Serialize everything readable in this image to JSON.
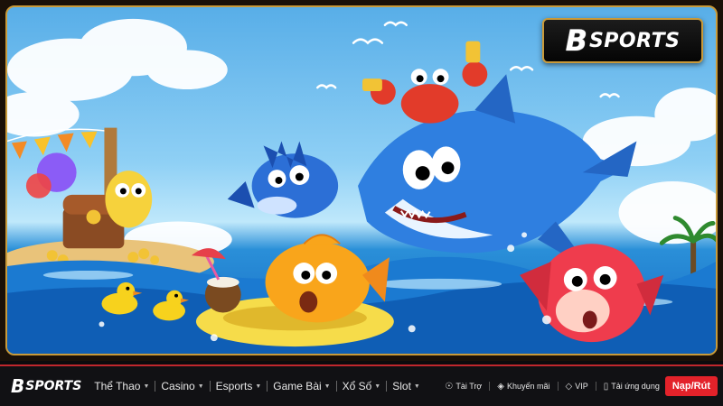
{
  "hero": {
    "badge_b": "B",
    "badge_word": "SPORTS"
  },
  "nav": {
    "logo_b": "B",
    "logo_word": "SPORTS",
    "menu": [
      {
        "label": "Thể Thao"
      },
      {
        "label": "Casino"
      },
      {
        "label": "Esports"
      },
      {
        "label": "Game Bài"
      },
      {
        "label": "Xổ Số"
      },
      {
        "label": "Slot"
      }
    ],
    "quick": [
      {
        "label": "Tài Trợ",
        "icon": "sponsor-icon"
      },
      {
        "label": "Khuyến mãi",
        "icon": "promotion-icon"
      },
      {
        "label": "VIP",
        "icon": "vip-icon"
      },
      {
        "label": "Tải ứng dụng",
        "icon": "mobile-app-icon"
      }
    ],
    "deposit_label": "Nạp/Rút"
  },
  "colors": {
    "accent_red": "#e3222a",
    "frame_gold": "#c99a3a",
    "nav_bg": "#111114"
  }
}
